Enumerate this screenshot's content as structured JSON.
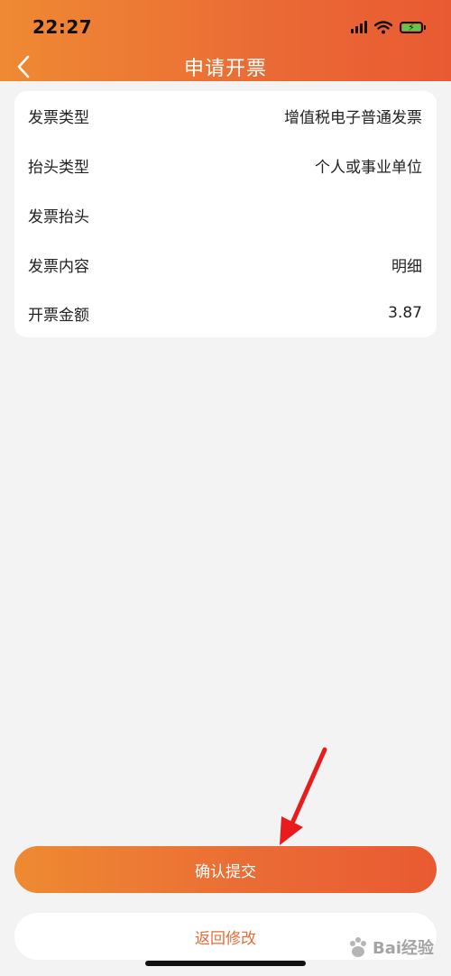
{
  "status_bar": {
    "time": "22:27",
    "icons": [
      "signal-icon",
      "wifi-icon",
      "battery-charging-icon"
    ]
  },
  "header": {
    "title": "申请开票",
    "back_icon": "chevron-left-icon"
  },
  "invoice": {
    "rows": [
      {
        "label": "发票类型",
        "value": "增值税电子普通发票"
      },
      {
        "label": "抬头类型",
        "value": "个人或事业单位"
      },
      {
        "label": "发票抬头",
        "value": ""
      },
      {
        "label": "发票内容",
        "value": "明细"
      },
      {
        "label": "开票金额",
        "value": "3.87"
      }
    ]
  },
  "actions": {
    "confirm_label": "确认提交",
    "back_label": "返回修改"
  },
  "watermark": {
    "text": "Bai经验"
  },
  "colors": {
    "accent_start": "#ef8a33",
    "accent_end": "#e95a32",
    "background": "#f3f3f3",
    "annotation_arrow": "#e81c1c"
  }
}
